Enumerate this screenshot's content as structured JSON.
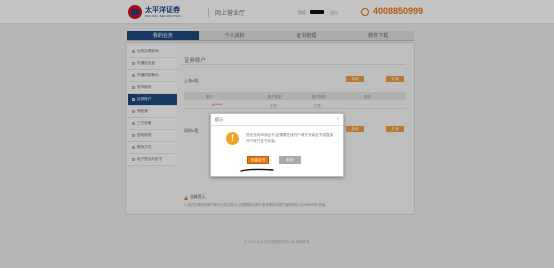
{
  "header": {
    "brand_cn": "太平洋证券",
    "brand_en": "PACIFIC SECURITIES",
    "site_name": "网上营业厅",
    "user_label": "您好,",
    "links": "退出",
    "phone": "4008850999"
  },
  "nav": {
    "tabs": [
      {
        "label": "我的业务",
        "active": true
      },
      {
        "label": "个人资料",
        "active": false
      },
      {
        "label": "证书管理",
        "active": false
      },
      {
        "label": "软件下载",
        "active": false
      }
    ]
  },
  "sidebar": {
    "items": [
      {
        "label": "业务办理查询",
        "active": false
      },
      {
        "label": "开通创业板",
        "active": false
      },
      {
        "label": "开通风险警示",
        "active": false
      },
      {
        "label": "退市板块",
        "active": false
      },
      {
        "label": "证券账户",
        "active": true
      },
      {
        "label": "港股通",
        "active": false
      },
      {
        "label": "三方存管",
        "active": false
      },
      {
        "label": "密码修改",
        "active": false
      },
      {
        "label": "联系方式",
        "active": false
      },
      {
        "label": "电子签名约定书",
        "active": false
      }
    ]
  },
  "main": {
    "title": "证券账户",
    "market1": "上海A股",
    "market2": "深圳A股",
    "btn_add": "新增",
    "btn_open": "开通",
    "columns": [
      "账户",
      "账户类型",
      "账户状态",
      "操作"
    ],
    "row": {
      "account": "A******",
      "type": "正常",
      "status": "正常"
    }
  },
  "tips": {
    "title": "温馨提示",
    "text": "1. 您在办理证券账户新开业务过程中,请按照提示操作,如有疑问请拨打客服热线 4008850999 咨询。"
  },
  "footer": {
    "text": "© 2015 太平洋证券股份有限公司 版权所有"
  },
  "dialog": {
    "title": "提示",
    "close": "×",
    "icon": "!",
    "message": "您还没有申请证书,如需要在线开户请先安装证书或直接开户进行证书安装。",
    "ok_label": "安装证书",
    "cancel_label": "取消"
  },
  "colors": {
    "nav_active": "#1d4a7d",
    "accent_orange": "#e8750a",
    "warning_icon": "#f0a52a"
  }
}
